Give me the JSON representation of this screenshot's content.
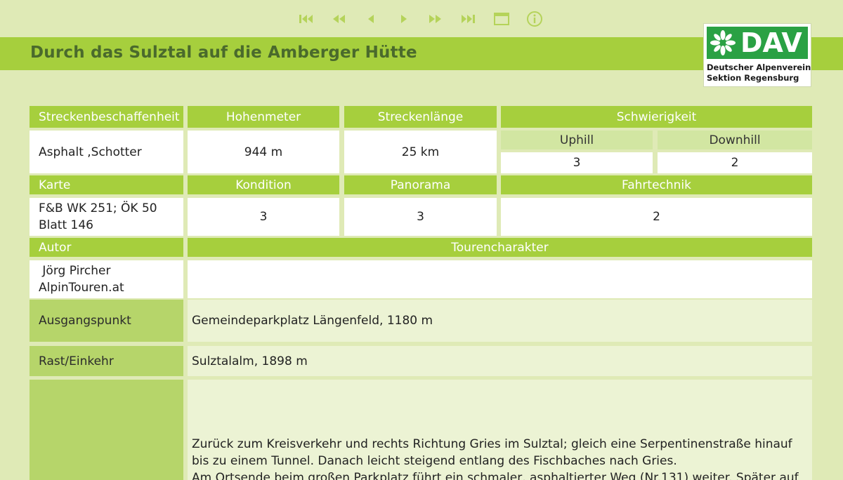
{
  "nav": {
    "first_icon": "skip-first-icon",
    "prev_fast_icon": "fast-back-icon",
    "prev_icon": "prev-icon",
    "next_icon": "next-icon",
    "next_fast_icon": "fast-forward-icon",
    "last_icon": "skip-last-icon",
    "window_icon": "window-icon",
    "info_icon": "info-icon"
  },
  "header": {
    "title": "Durch das Sulztal auf die Amberger Hütte"
  },
  "logo": {
    "brand": "DAV",
    "line1": "Deutscher Alpenverein",
    "line2": "Sektion Regensburg"
  },
  "table": {
    "row1_headers": {
      "streckenbeschaffenheit": "Streckenbeschaffenheit",
      "hohenmeter": "Hohenmeter",
      "streckenlaenge": "Streckenlänge",
      "schwierigkeit": "Schwierigkeit"
    },
    "row1_sub": {
      "uphill": "Uphill",
      "downhill": "Downhill"
    },
    "row1_values": {
      "streckenbeschaffenheit": "Asphalt ,Schotter",
      "hohenmeter": "944 m",
      "streckenlaenge": "25 km",
      "uphill": "3",
      "downhill": "2"
    },
    "row2_headers": {
      "karte": "Karte",
      "kondition": "Kondition",
      "panorama": "Panorama",
      "fahrtechnik": "Fahrtechnik"
    },
    "row2_values": {
      "karte_line1": "F&B WK 251; ÖK 50",
      "karte_line2": "Blatt 146",
      "kondition": "3",
      "panorama": "3",
      "fahrtechnik": "2"
    },
    "row3_headers": {
      "autor": "Autor",
      "tourencharakter": "Tourencharakter"
    },
    "row3_values": {
      "autor_line1": " Jörg Pircher",
      "autor_line2": "AlpinTouren.at",
      "tourencharakter": ""
    }
  },
  "details": {
    "ausgangspunkt_label": "Ausgangspunkt",
    "ausgangspunkt_value": "Gemeindeparkplatz Längenfeld, 1180 m",
    "rast_label": "Rast/Einkehr",
    "rast_value": "Sulztalalm, 1898 m",
    "description_line1": "Zurück zum Kreisverkehr und rechts Richtung Gries im Sulztal; gleich eine Serpentinenstraße hinauf",
    "description_line2": "bis zu einem Tunnel. Danach leicht steigend entlang des Fischbaches nach Gries.",
    "description_line3": "Am Ortsende beim großen Parkplatz führt ein schmaler, asphaltierter Weg (Nr.131) weiter. Später auf"
  },
  "colors": {
    "page_bg": "#dfeab6",
    "header_green": "#a6cf3d",
    "title_text": "#4a6a2c",
    "nav_icon": "#b5d35a",
    "logo_green": "#2aa144"
  }
}
